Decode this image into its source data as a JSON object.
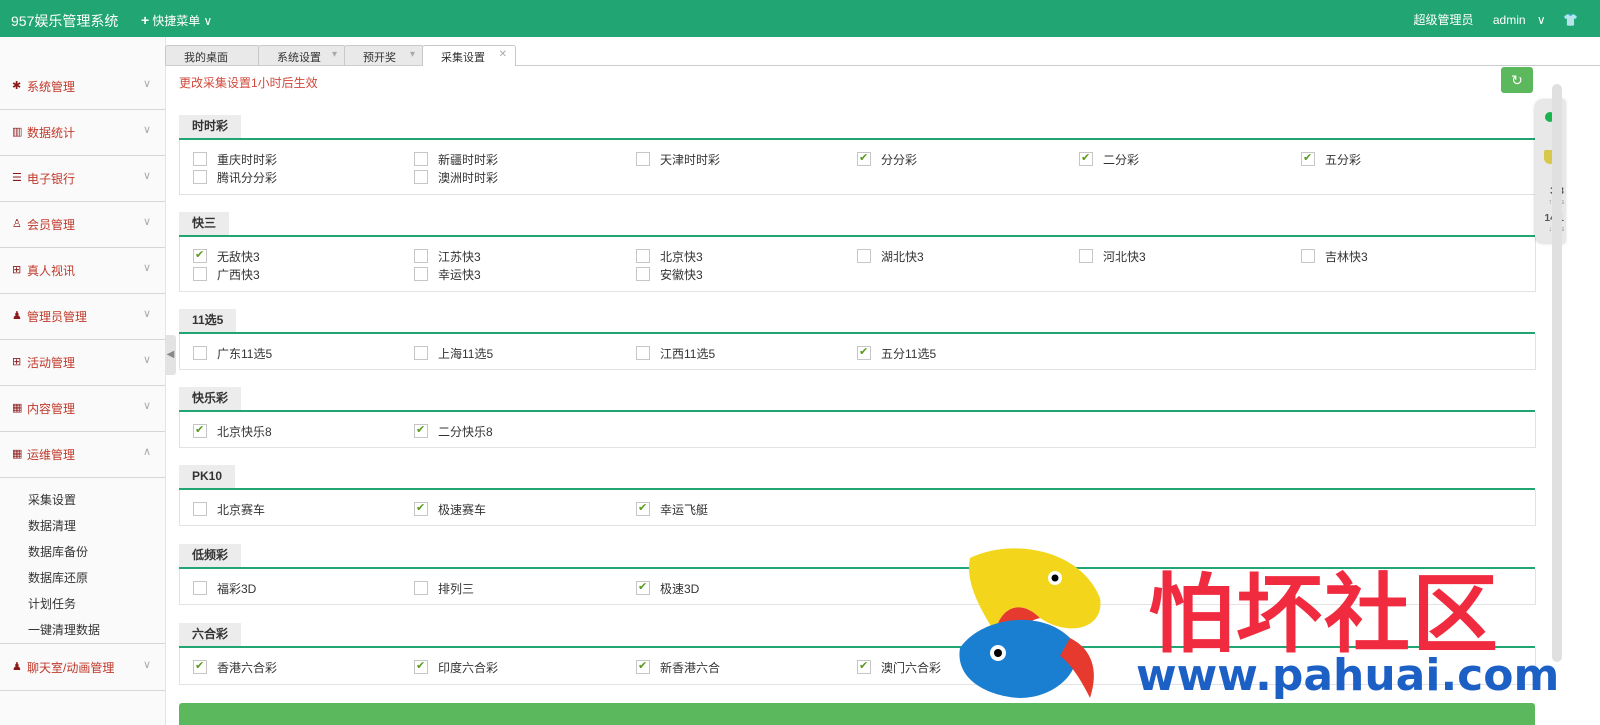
{
  "topbar": {
    "brand": "957娱乐管理系统",
    "quick_menu": "快捷菜单",
    "role": "超级管理员",
    "user": "admin",
    "chevron": "∨",
    "shirt_icon": "👕"
  },
  "sidebar": {
    "items": [
      {
        "icon": "✱",
        "label": "系统管理",
        "arrow": "∨"
      },
      {
        "icon": "▥",
        "label": "数据统计",
        "arrow": "∨"
      },
      {
        "icon": "☰",
        "label": "电子银行",
        "arrow": "∨"
      },
      {
        "icon": "♙",
        "label": "会员管理",
        "arrow": "∨"
      },
      {
        "icon": "⊞",
        "label": "真人视讯",
        "arrow": "∨"
      },
      {
        "icon": "♟",
        "label": "管理员管理",
        "arrow": "∨"
      },
      {
        "icon": "⊞",
        "label": "活动管理",
        "arrow": "∨"
      },
      {
        "icon": "▦",
        "label": "内容管理",
        "arrow": "∨"
      },
      {
        "icon": "▦",
        "label": "运维管理",
        "arrow": "∧"
      }
    ],
    "submenu": [
      "采集设置",
      "数据清理",
      "数据库备份",
      "数据库还原",
      "计划任务",
      "一键清理数据"
    ],
    "last_item": {
      "icon": "♟",
      "label": "聊天室/动画管理",
      "arrow": "∨"
    },
    "collapse_glyph": "◀"
  },
  "tabs": [
    {
      "label": "我的桌面",
      "close": ""
    },
    {
      "label": "系统设置",
      "close": "▾"
    },
    {
      "label": "预开奖",
      "close": "▾"
    },
    {
      "label": "采集设置",
      "close": "✕"
    }
  ],
  "notice": "更改采集设置1小时后生效",
  "refresh_glyph": "↻",
  "sections": [
    {
      "title": "时时彩",
      "options": [
        {
          "label": "重庆时时彩",
          "checked": false
        },
        {
          "label": "新疆时时彩",
          "checked": false
        },
        {
          "label": "天津时时彩",
          "checked": false
        },
        {
          "label": "分分彩",
          "checked": true
        },
        {
          "label": "二分彩",
          "checked": true
        },
        {
          "label": "五分彩",
          "checked": true
        },
        {
          "label": "腾讯分分彩",
          "checked": false
        },
        {
          "label": "澳洲时时彩",
          "checked": false
        }
      ]
    },
    {
      "title": "快三",
      "options": [
        {
          "label": "无敌快3",
          "checked": true
        },
        {
          "label": "江苏快3",
          "checked": false
        },
        {
          "label": "北京快3",
          "checked": false
        },
        {
          "label": "湖北快3",
          "checked": false
        },
        {
          "label": "河北快3",
          "checked": false
        },
        {
          "label": "吉林快3",
          "checked": false
        },
        {
          "label": "广西快3",
          "checked": false
        },
        {
          "label": "幸运快3",
          "checked": false
        },
        {
          "label": "安徽快3",
          "checked": false
        }
      ]
    },
    {
      "title": "11选5",
      "options": [
        {
          "label": "广东11选5",
          "checked": false
        },
        {
          "label": "上海11选5",
          "checked": false
        },
        {
          "label": "江西11选5",
          "checked": false
        },
        {
          "label": "五分11选5",
          "checked": true
        }
      ]
    },
    {
      "title": "快乐彩",
      "options": [
        {
          "label": "北京快乐8",
          "checked": true
        },
        {
          "label": "二分快乐8",
          "checked": true
        }
      ]
    },
    {
      "title": "PK10",
      "options": [
        {
          "label": "北京赛车",
          "checked": false
        },
        {
          "label": "极速赛车",
          "checked": true
        },
        {
          "label": "幸运飞艇",
          "checked": true
        }
      ]
    },
    {
      "title": "低频彩",
      "options": [
        {
          "label": "福彩3D",
          "checked": false
        },
        {
          "label": "排列三",
          "checked": false
        },
        {
          "label": "极速3D",
          "checked": true
        }
      ]
    },
    {
      "title": "六合彩",
      "options": [
        {
          "label": "香港六合彩",
          "checked": true
        },
        {
          "label": "印度六合彩",
          "checked": true
        },
        {
          "label": "新香港六合",
          "checked": true
        },
        {
          "label": "澳门六合彩",
          "checked": true
        }
      ]
    }
  ],
  "float_panel": {
    "up_value": "3.3",
    "up_unit": "↑ K/s",
    "down_value": "14.1",
    "down_unit": "↓ K/s"
  },
  "watermark": {
    "text": "怕坏社区",
    "url": "www.pahuai.com"
  }
}
